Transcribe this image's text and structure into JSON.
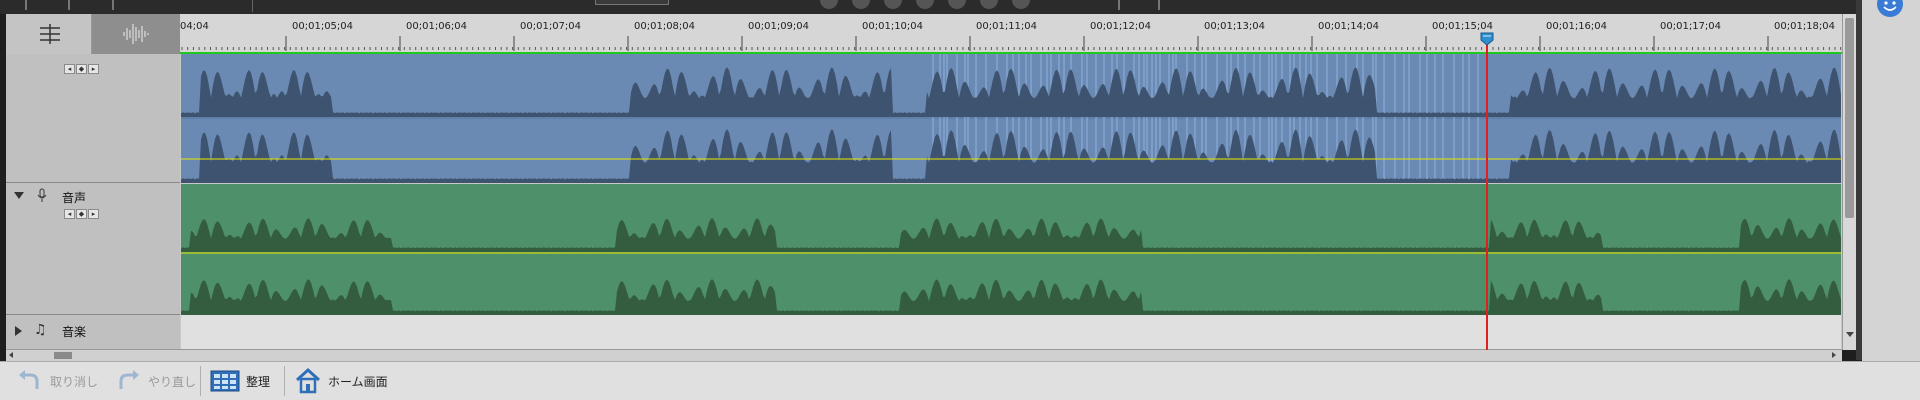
{
  "ruler": {
    "labels": [
      "04;04",
      "00;01;05;04",
      "00;01;06;04",
      "00;01;07;04",
      "00;01;08;04",
      "00;01;09;04",
      "00;01;10;04",
      "00;01;11;04",
      "00;01;12;04",
      "00;01;13;04",
      "00;01;14;04",
      "00;01;15;04",
      "00;01;16;04",
      "00;01;17;04",
      "00;01;18;04"
    ]
  },
  "tracks": {
    "voice": {
      "name": "音声"
    },
    "music": {
      "name": "音楽"
    }
  },
  "keyframe_nav": {
    "prev": "◂",
    "add": "◆",
    "next": "▸"
  },
  "footer": {
    "undo": "取り消し",
    "redo": "やり直し",
    "organize": "整理",
    "home": "ホーム画面"
  },
  "colors": {
    "video_audio_clip": "#6a89b3",
    "voice_clip": "#4e9069",
    "waveform_dark_blue": "#3d536f",
    "waveform_dark_green": "#345c3f",
    "volume_line": "#e8e800",
    "playhead": "#e02020"
  }
}
